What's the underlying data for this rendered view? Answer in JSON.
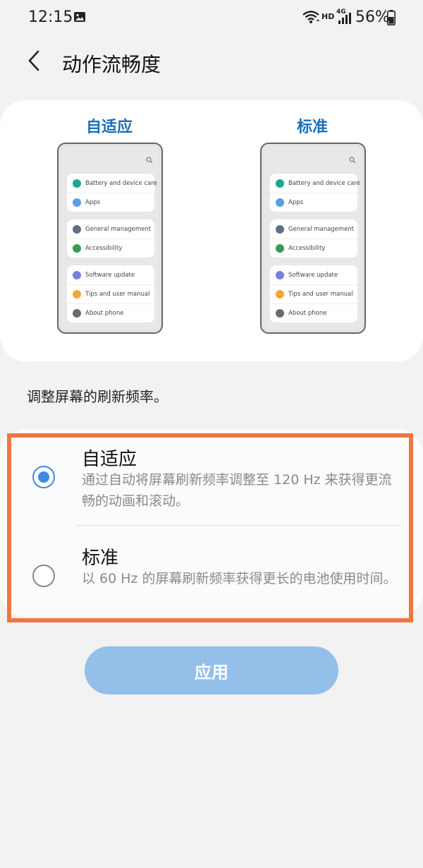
{
  "status_bar": {
    "time": "12:15",
    "hd": "HD",
    "network": "4G",
    "battery": "56%"
  },
  "header": {
    "title": "动作流畅度"
  },
  "preview": {
    "adaptive_label": "自适应",
    "standard_label": "标准",
    "phone_groups": [
      {
        "items": [
          {
            "label": "Battery and device care",
            "icon": "battery-care-icon",
            "color": "#1fa68e"
          },
          {
            "label": "Apps",
            "icon": "apps-icon",
            "color": "#5b9ee6"
          }
        ]
      },
      {
        "items": [
          {
            "label": "General management",
            "icon": "sliders-icon",
            "color": "#5f6f84"
          },
          {
            "label": "Accessibility",
            "icon": "accessibility-icon",
            "color": "#3a9a55"
          }
        ]
      },
      {
        "items": [
          {
            "label": "Software update",
            "icon": "software-update-icon",
            "color": "#7b7ee0"
          },
          {
            "label": "Tips and user manual",
            "icon": "lightbulb-icon",
            "color": "#f0a63a"
          },
          {
            "label": "About phone",
            "icon": "info-icon",
            "color": "#6b6b6b"
          }
        ]
      }
    ]
  },
  "description": "调整屏幕的刷新频率。",
  "options": [
    {
      "title": "自适应",
      "desc": "通过自动将屏幕刷新频率调整至 120 Hz 来获得更流畅的动画和滚动。",
      "selected": true
    },
    {
      "title": "标准",
      "desc": "以 60 Hz 的屏幕刷新频率获得更长的电池使用时间。",
      "selected": false
    }
  ],
  "apply_label": "应用",
  "colors": {
    "accent": "#3d8ae6",
    "title_blue": "#1a6fb8",
    "highlight": "#f07545",
    "button": "#93bfe9"
  }
}
